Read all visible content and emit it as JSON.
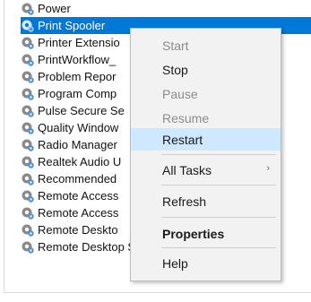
{
  "services": [
    {
      "name": "Power",
      "selected": false
    },
    {
      "name": "Print Spooler",
      "selected": true
    },
    {
      "name": "Printer Extensio",
      "selected": false
    },
    {
      "name": "PrintWorkflow_",
      "selected": false
    },
    {
      "name": "Problem Repor",
      "selected": false
    },
    {
      "name": "Program Comp",
      "selected": false
    },
    {
      "name": "Pulse Secure Se",
      "selected": false
    },
    {
      "name": "Quality Window",
      "selected": false
    },
    {
      "name": "Radio Manager",
      "selected": false
    },
    {
      "name": "Realtek Audio U",
      "selected": false
    },
    {
      "name": "Recommended",
      "selected": false
    },
    {
      "name": "Remote Access",
      "selected": false
    },
    {
      "name": "Remote Access",
      "selected": false
    },
    {
      "name": "Remote Deskto",
      "selected": false
    },
    {
      "name": "Remote Desktop Services",
      "selected": false
    }
  ],
  "context_menu": {
    "start": "Start",
    "stop": "Stop",
    "pause": "Pause",
    "resume": "Resume",
    "restart": "Restart",
    "all_tasks": "All Tasks",
    "all_tasks_arrow": "›",
    "refresh": "Refresh",
    "properties": "Properties",
    "help": "Help"
  },
  "colors": {
    "selection": "#0078d7",
    "menu_highlight": "#cde8ff",
    "menu_background": "#f2f2f2",
    "disabled_text": "#8c8c8c"
  },
  "icons": {
    "service": "gear-service-icon",
    "submenu": "chevron-right-icon"
  }
}
